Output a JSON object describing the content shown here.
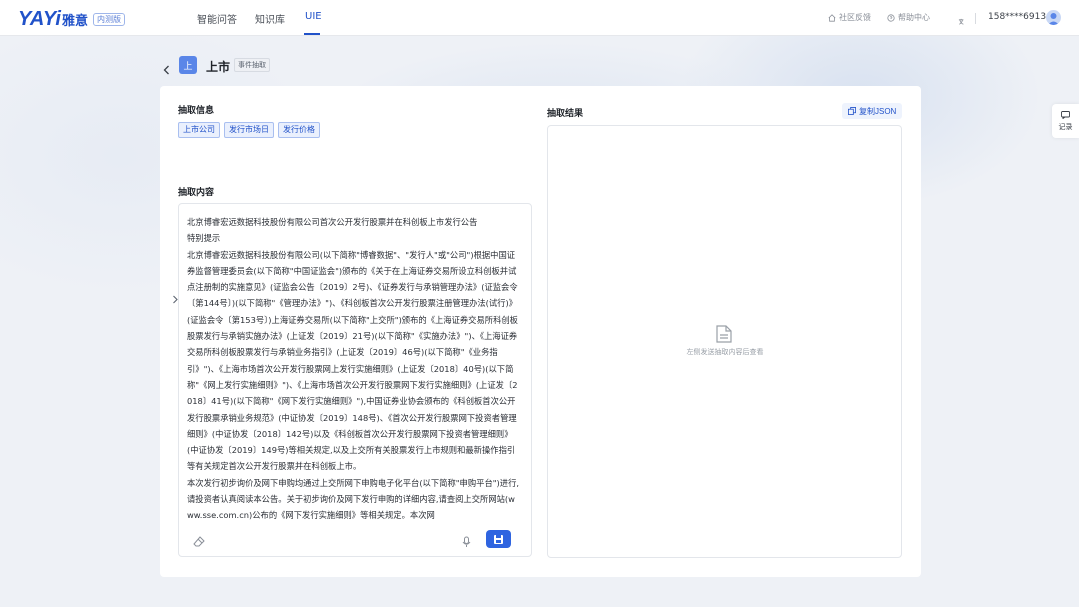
{
  "logo": {
    "brand": "YAYi",
    "brand_cn": "雅意",
    "badge": "内测版"
  },
  "nav": {
    "tabs": [
      {
        "label": "智能问答"
      },
      {
        "label": "知识库"
      },
      {
        "label": "UIE",
        "active": true
      }
    ],
    "community_feedback": "社区反馈",
    "help_center": "帮助中心",
    "phone": "158****6913"
  },
  "header": {
    "icon_char": "上",
    "title": "上市",
    "tag": "事件抽取"
  },
  "extraction_info": {
    "label": "抽取信息",
    "tags": [
      "上市公司",
      "发行市场日",
      "发行价格"
    ]
  },
  "extraction_content": {
    "label": "抽取内容",
    "text": "北京博睿宏远数据科技股份有限公司首次公开发行股票并在科创板上市发行公告\n特别提示\n北京博睿宏远数据科技股份有限公司(以下简称\"博睿数据\"、\"发行人\"或\"公司\")根据中国证券监督管理委员会(以下简称\"中国证监会\")颁布的《关于在上海证券交易所设立科创板并试点注册制的实施意见》(证监会公告〔2019〕2号)、《证券发行与承销管理办法》(证监会令〔第144号〕)(以下简称\"《管理办法》\")、《科创板首次公开发行股票注册管理办法(试行)》(证监会令〔第153号〕)上海证券交易所(以下简称\"上交所\")颁布的《上海证券交易所科创板股票发行与承销实施办法》(上证发〔2019〕21号)(以下简称\"《实施办法》\")、《上海证券交易所科创板股票发行与承销业务指引》(上证发〔2019〕46号)(以下简称\"《业务指引》\")、《上海市场首次公开发行股票网上发行实施细则》(上证发〔2018〕40号)(以下简称\"《网上发行实施细则》\")、《上海市场首次公开发行股票网下发行实施细则》(上证发〔2018〕41号)(以下简称\"《网下发行实施细则》\"),中国证券业协会颁布的《科创板首次公开发行股票承销业务规范》(中证协发〔2019〕148号)、《首次公开发行股票网下投资者管理细则》(中证协发〔2018〕142号)以及《科创板首次公开发行股票网下投资者管理细则》(中证协发〔2019〕149号)等相关规定,以及上交所有关股票发行上市规则和最新操作指引等有关规定首次公开发行股票并在科创板上市。\n本次发行初步询价及网下申购均通过上交所网下申购电子化平台(以下简称\"申购平台\")进行,请投资者认真阅读本公告。关于初步询价及网下发行申购的详细内容,请查阅上交所网站(www.sse.com.cn)公布的《网下发行实施细则》等相关规定。本次网"
  },
  "extraction_result": {
    "label": "抽取结果",
    "copy_label": "复制JSON",
    "empty_text": "左侧发送抽取内容后查看"
  },
  "side": {
    "record_label": "记录"
  }
}
